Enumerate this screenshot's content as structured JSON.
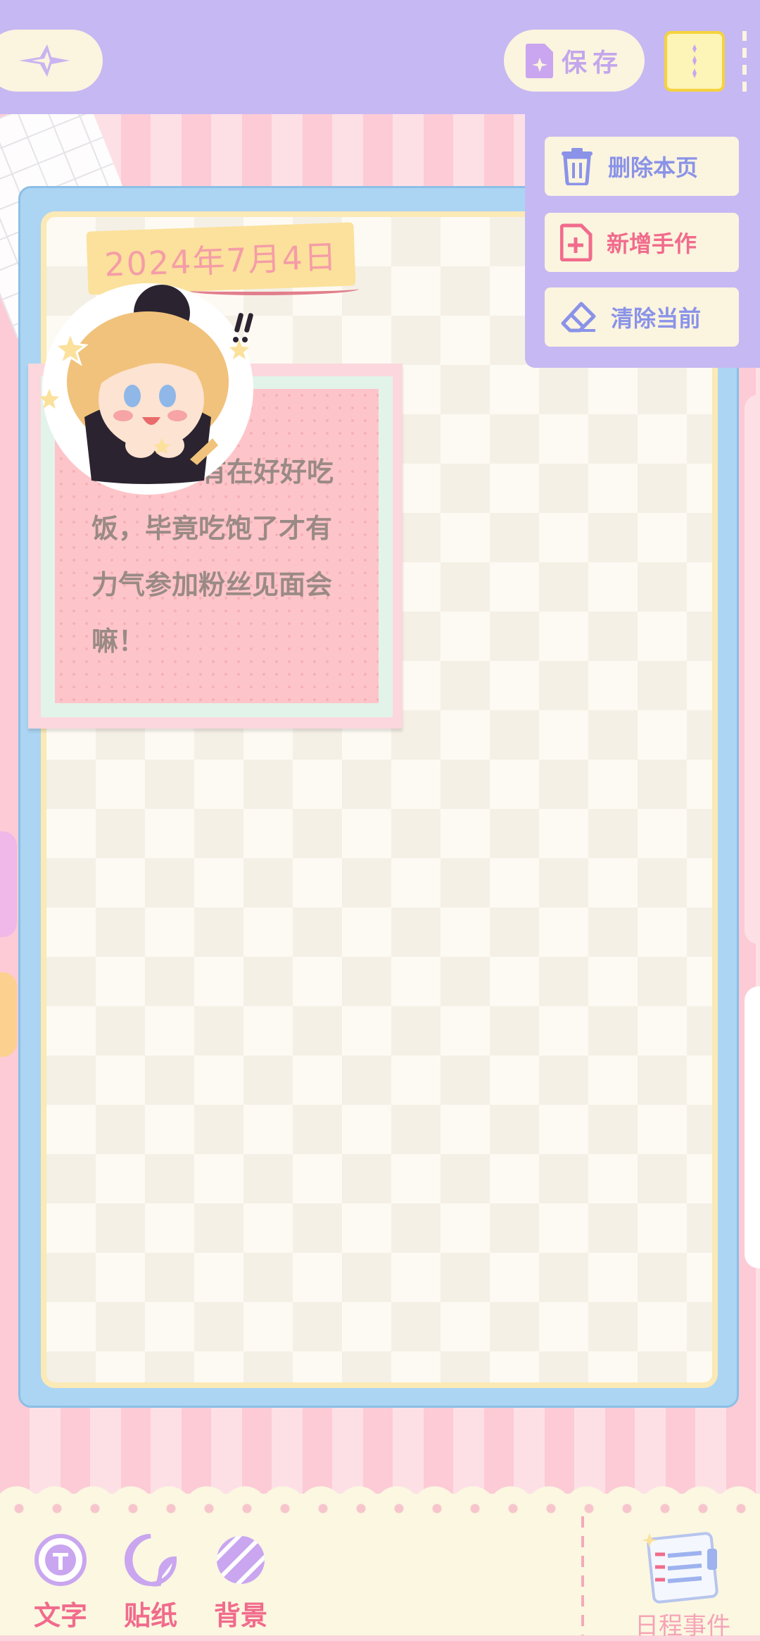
{
  "header": {
    "save_label": "保存"
  },
  "menu": {
    "items": [
      {
        "label": "删除本页",
        "color": "#8a93e8"
      },
      {
        "label": "新增手作",
        "color": "#f16b8c"
      },
      {
        "label": "清除当前",
        "color": "#8a93e8"
      }
    ]
  },
  "journal": {
    "date": "2024年7月4日",
    "note": "Peacoo有在好好吃饭，毕竟吃饱了才有力气参加粉丝见面会嘛！"
  },
  "toolbar": {
    "tools": [
      {
        "label": "文字",
        "icon": "text-t-icon"
      },
      {
        "label": "贴纸",
        "icon": "sticker-icon"
      },
      {
        "label": "背景",
        "icon": "background-stripes-icon"
      }
    ],
    "schedule_label": "日程事件"
  },
  "colors": {
    "topbar": "#c6b8f2",
    "accent_pink": "#f16b8c",
    "accent_blue": "#8a93e8",
    "card_border": "#abd5f3"
  }
}
